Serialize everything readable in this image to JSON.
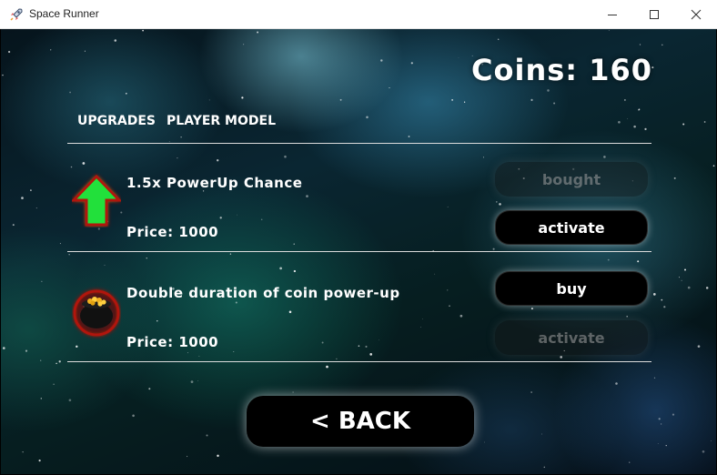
{
  "window": {
    "title": "Space Runner",
    "app_icon": "rocket-icon",
    "controls": [
      "minimize-icon",
      "maximize-icon",
      "close-icon"
    ]
  },
  "header": {
    "coins_label": "Coins: 160"
  },
  "tabs": [
    {
      "label": "UPGRADES"
    },
    {
      "label": "PLAYER MODEL"
    }
  ],
  "upgrades": [
    {
      "title": "1.5x PowerUp Chance",
      "price": "Price: 1000",
      "icon": "green-arrow-up-icon",
      "primary_button": {
        "label": "bought",
        "enabled": false
      },
      "secondary_button": {
        "label": "activate",
        "enabled": true
      }
    },
    {
      "title": "Double duration of coin power-up",
      "price": "Price: 1000",
      "icon": "pot-of-gold-icon",
      "primary_button": {
        "label": "buy",
        "enabled": true
      },
      "secondary_button": {
        "label": "activate",
        "enabled": false
      }
    }
  ],
  "back_button": {
    "label": "< BACK"
  },
  "colors": {
    "arrow_green": "#22e03a",
    "icon_red_glow": "#b0120f",
    "button_bg": "#000000",
    "text": "#ffffff"
  }
}
